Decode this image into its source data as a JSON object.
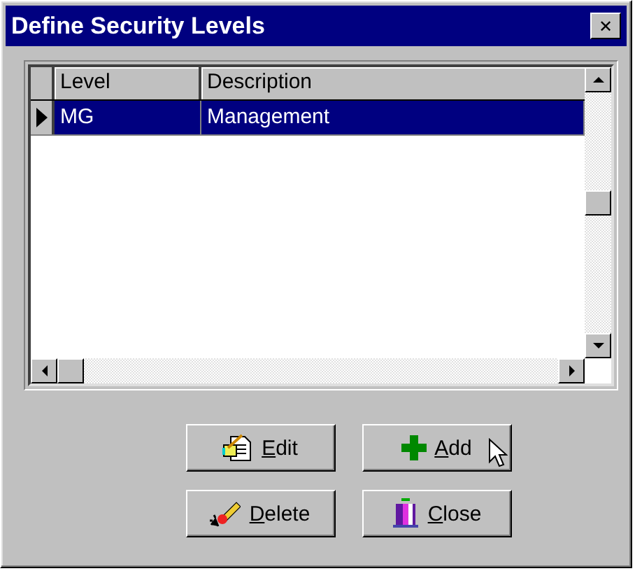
{
  "window": {
    "title": "Define Security Levels",
    "close": "✕"
  },
  "table": {
    "columns": [
      "Level",
      "Description"
    ],
    "rows": [
      {
        "cells": [
          "MG",
          "Management"
        ],
        "selected": true
      }
    ]
  },
  "buttons": [
    {
      "label": "Edit",
      "kind": "edit"
    },
    {
      "label": "Add",
      "kind": "add"
    },
    {
      "label": "Delete",
      "kind": "delete"
    },
    {
      "label": "Close",
      "kind": "close"
    }
  ]
}
